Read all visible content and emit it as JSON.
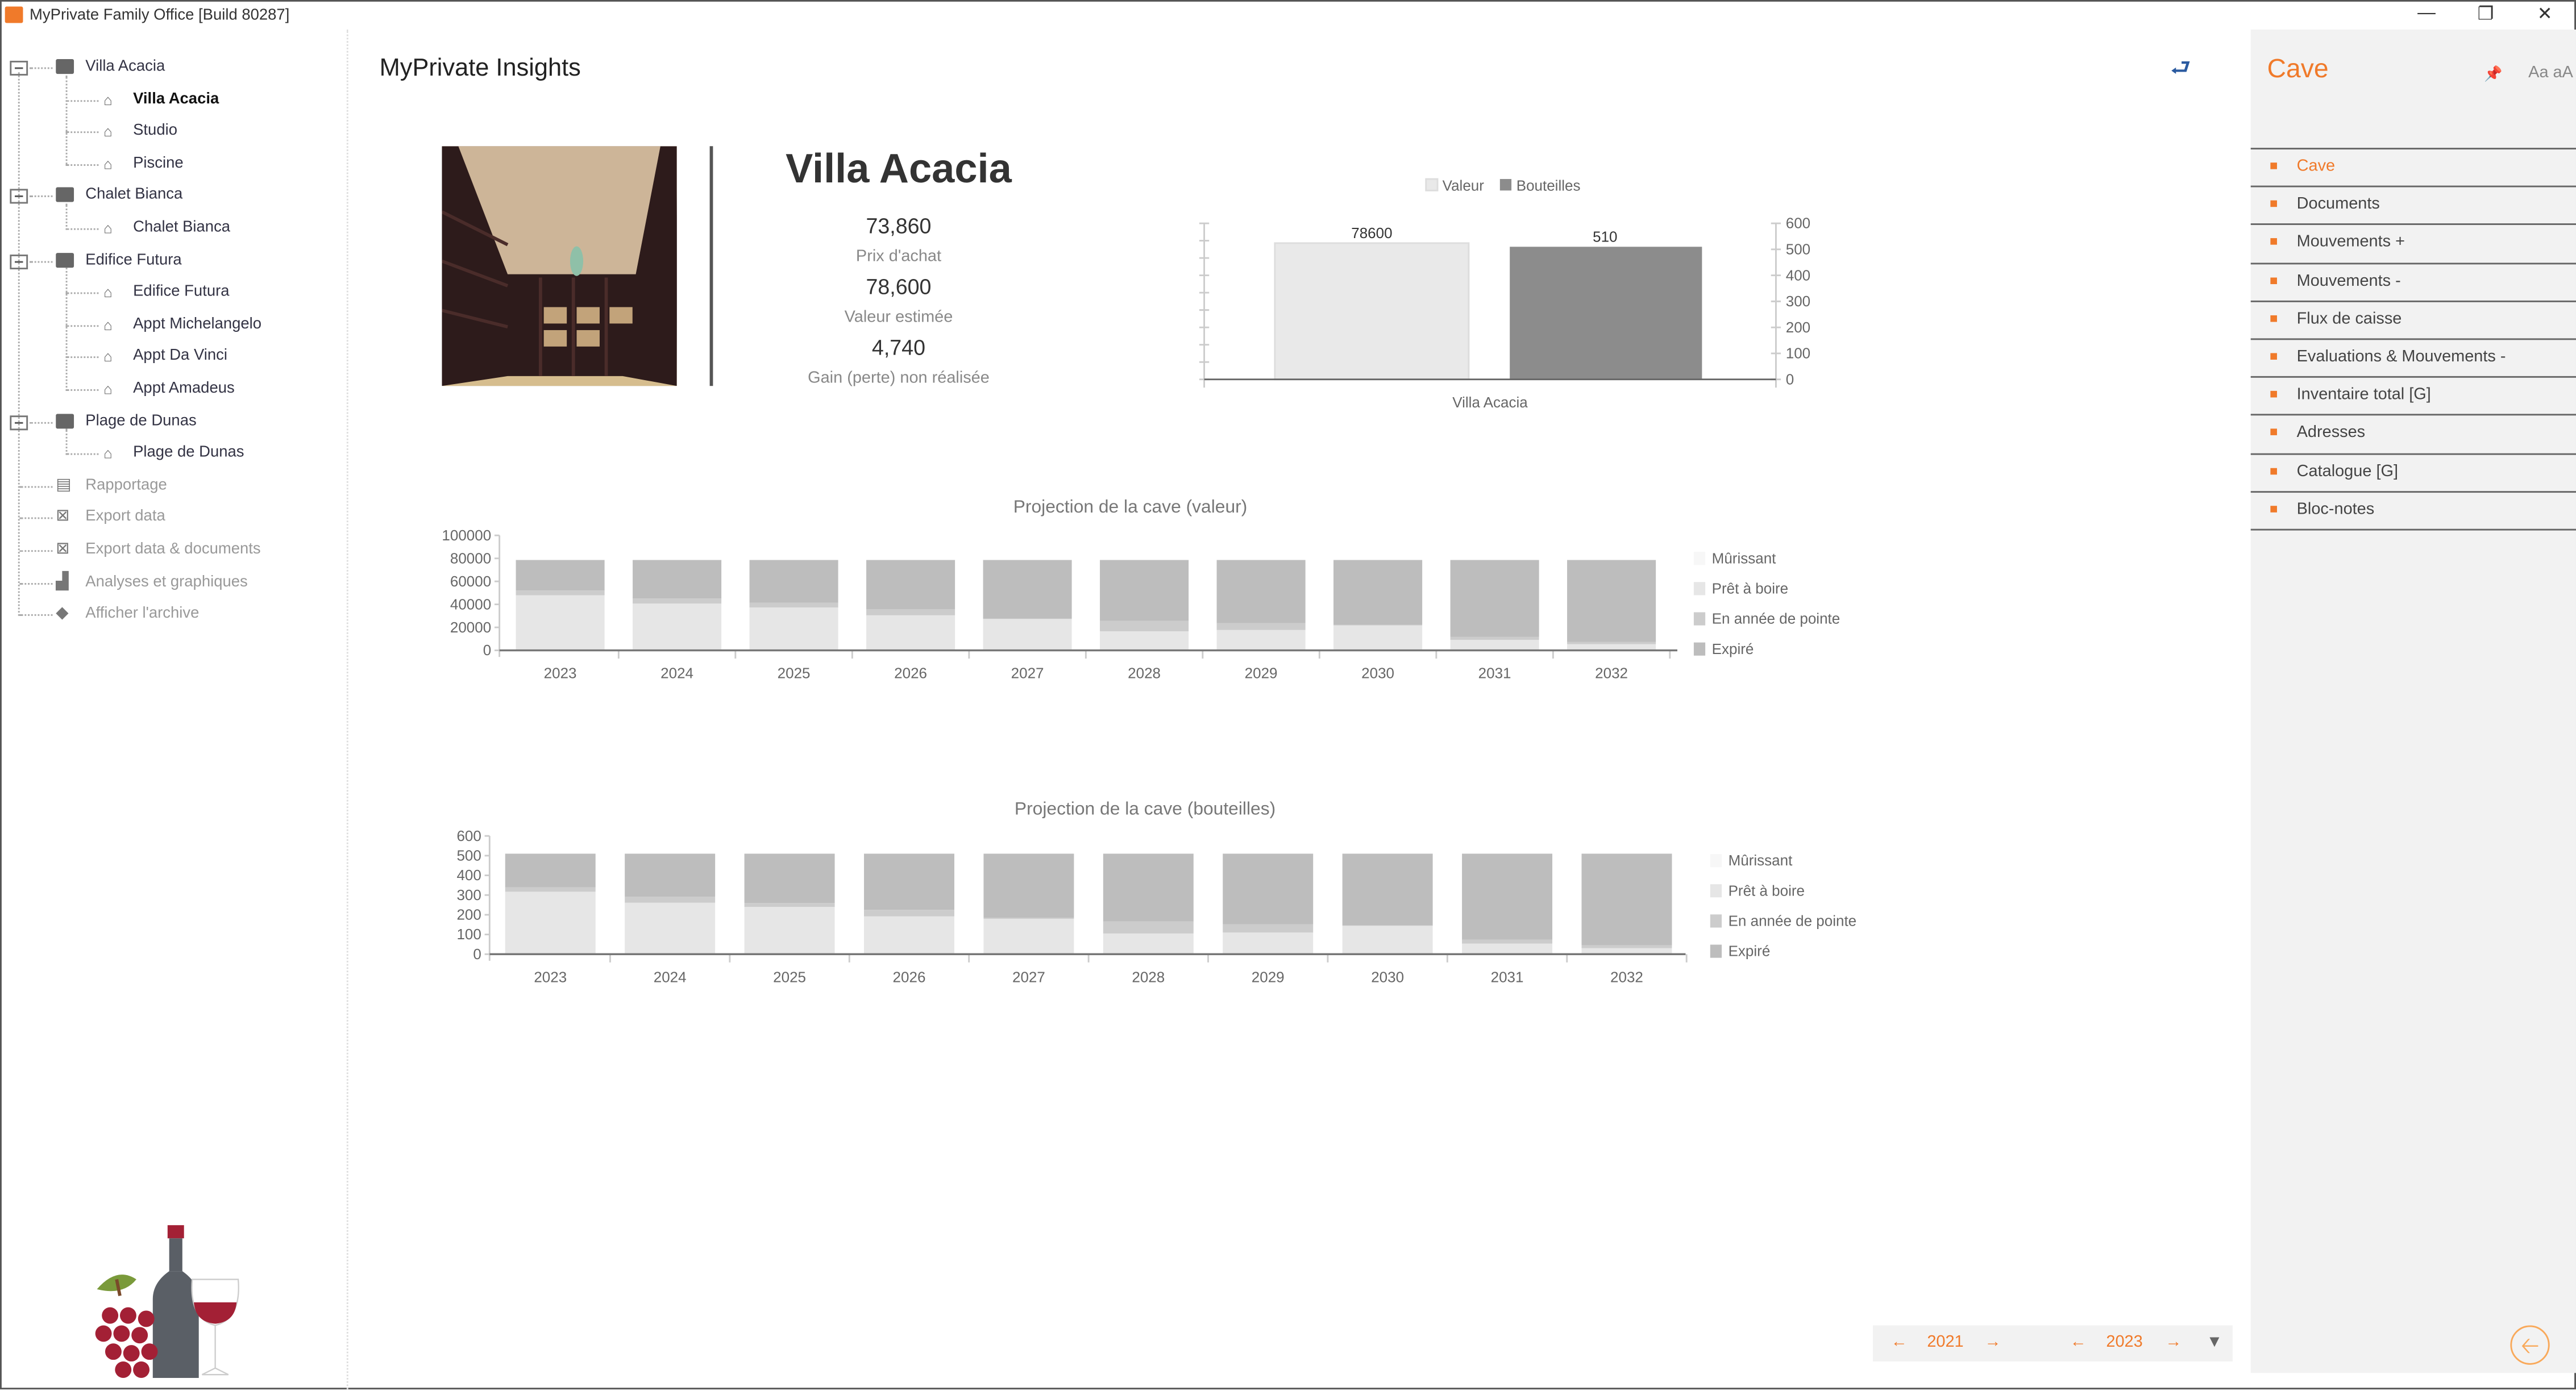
{
  "window": {
    "title": "MyPrivate Family Office [Build 80287]",
    "controls": [
      "minimize-icon",
      "restore-icon",
      "close-icon"
    ]
  },
  "sidebar": {
    "groups": [
      {
        "label": "Villa Acacia",
        "children": [
          "Villa Acacia",
          "Studio",
          "Piscine"
        ],
        "selected_child": 0
      },
      {
        "label": "Chalet Bianca",
        "children": [
          "Chalet Bianca"
        ]
      },
      {
        "label": "Edifice Futura",
        "children": [
          "Edifice Futura",
          "Appt Michelangelo",
          "Appt Da Vinci",
          "Appt Amadeus"
        ]
      },
      {
        "label": "Plage de Dunas",
        "children": [
          "Plage de Dunas"
        ]
      }
    ],
    "tools": [
      {
        "label": "Rapportage",
        "icon": "report-icon"
      },
      {
        "label": "Export data",
        "icon": "excel-icon"
      },
      {
        "label": "Export data & documents",
        "icon": "excel-icon"
      },
      {
        "label": "Analyses et graphiques",
        "icon": "bar-chart-icon"
      },
      {
        "label": "Afficher l'archive",
        "icon": "archive-icon"
      }
    ]
  },
  "main": {
    "title": "MyPrivate Insights",
    "property": {
      "name": "Villa Acacia",
      "purchase_price": "73,860",
      "purchase_price_label": "Prix d'achat",
      "estimated_value": "78,600",
      "estimated_value_label": "Valeur estimée",
      "unrealized_gain": "4,740",
      "unrealized_gain_label": "Gain (perte) non réalisée"
    }
  },
  "right_panel": {
    "title": "Cave",
    "font_toggle": "Aa aA",
    "items": [
      "Cave",
      "Documents",
      "Mouvements +",
      "Mouvements -",
      "Flux de caisse",
      "Evaluations & Mouvements -",
      "Inventaire total [G]",
      "Adresses",
      "Catalogue [G]",
      "Bloc-notes"
    ],
    "active_index": 0
  },
  "bottom_bar": {
    "from_year": "2021",
    "to_year": "2023",
    "prev": "←",
    "next": "→"
  },
  "colors": {
    "accent": "#f07a2a",
    "murissant": "#f7f7f7",
    "pret": "#e6e6e6",
    "pointe": "#cccccc",
    "expire": "#bdbdbd",
    "valeur": "#e9e9e9",
    "bouteilles": "#8c8c8c"
  },
  "chart_data": [
    {
      "type": "bar",
      "title": "",
      "categories": [
        "Villa Acacia"
      ],
      "series": [
        {
          "name": "Valeur",
          "values": [
            78600
          ],
          "axis": "left"
        },
        {
          "name": "Bouteilles",
          "values": [
            510
          ],
          "axis": "right"
        }
      ],
      "data_labels": [
        "78600",
        "510"
      ],
      "ylim_left": [
        0,
        90000
      ],
      "ylim_right": [
        0,
        600
      ],
      "yticks_right": [
        "0",
        "100",
        "200",
        "300",
        "400",
        "500",
        "600"
      ],
      "legend": "top"
    },
    {
      "type": "bar",
      "stacked": true,
      "title": "Projection de la cave (valeur)",
      "categories": [
        "2023",
        "2024",
        "2025",
        "2026",
        "2027",
        "2028",
        "2029",
        "2030",
        "2031",
        "2032"
      ],
      "series": [
        {
          "name": "Mûrissant",
          "values": [
            0,
            0,
            0,
            0,
            0,
            0,
            0,
            0,
            0,
            0
          ]
        },
        {
          "name": "Prêt à boire",
          "values": [
            47900,
            40700,
            37300,
            30500,
            27300,
            16600,
            17700,
            21700,
            9100,
            5400
          ]
        },
        {
          "name": "En année de pointe",
          "values": [
            4200,
            4400,
            4200,
            5200,
            400,
            9000,
            6000,
            500,
            2600,
            1900
          ]
        },
        {
          "name": "Expiré",
          "values": [
            26500,
            33500,
            37100,
            42900,
            50900,
            53000,
            54900,
            56400,
            66900,
            71300
          ]
        }
      ],
      "ylim": [
        0,
        100000
      ],
      "yticks": [
        "0",
        "20000",
        "40000",
        "60000",
        "80000",
        "100000"
      ],
      "legend": "right"
    },
    {
      "type": "bar",
      "stacked": true,
      "title": "Projection de la cave (bouteilles)",
      "categories": [
        "2023",
        "2024",
        "2025",
        "2026",
        "2027",
        "2028",
        "2029",
        "2030",
        "2031",
        "2032"
      ],
      "series": [
        {
          "name": "Mûrissant",
          "values": [
            0,
            0,
            0,
            0,
            0,
            0,
            0,
            0,
            0,
            0
          ]
        },
        {
          "name": "Prêt à boire",
          "values": [
            317,
            261,
            240,
            192,
            179,
            105,
            110,
            144,
            54,
            31
          ]
        },
        {
          "name": "En année de pointe",
          "values": [
            22,
            31,
            20,
            33,
            6,
            61,
            42,
            2,
            20,
            14
          ]
        },
        {
          "name": "Expiré",
          "values": [
            171,
            218,
            250,
            285,
            325,
            344,
            358,
            364,
            436,
            465
          ]
        }
      ],
      "ylim": [
        0,
        600
      ],
      "yticks": [
        "0",
        "100",
        "200",
        "300",
        "400",
        "500",
        "600"
      ],
      "legend": "right"
    }
  ]
}
